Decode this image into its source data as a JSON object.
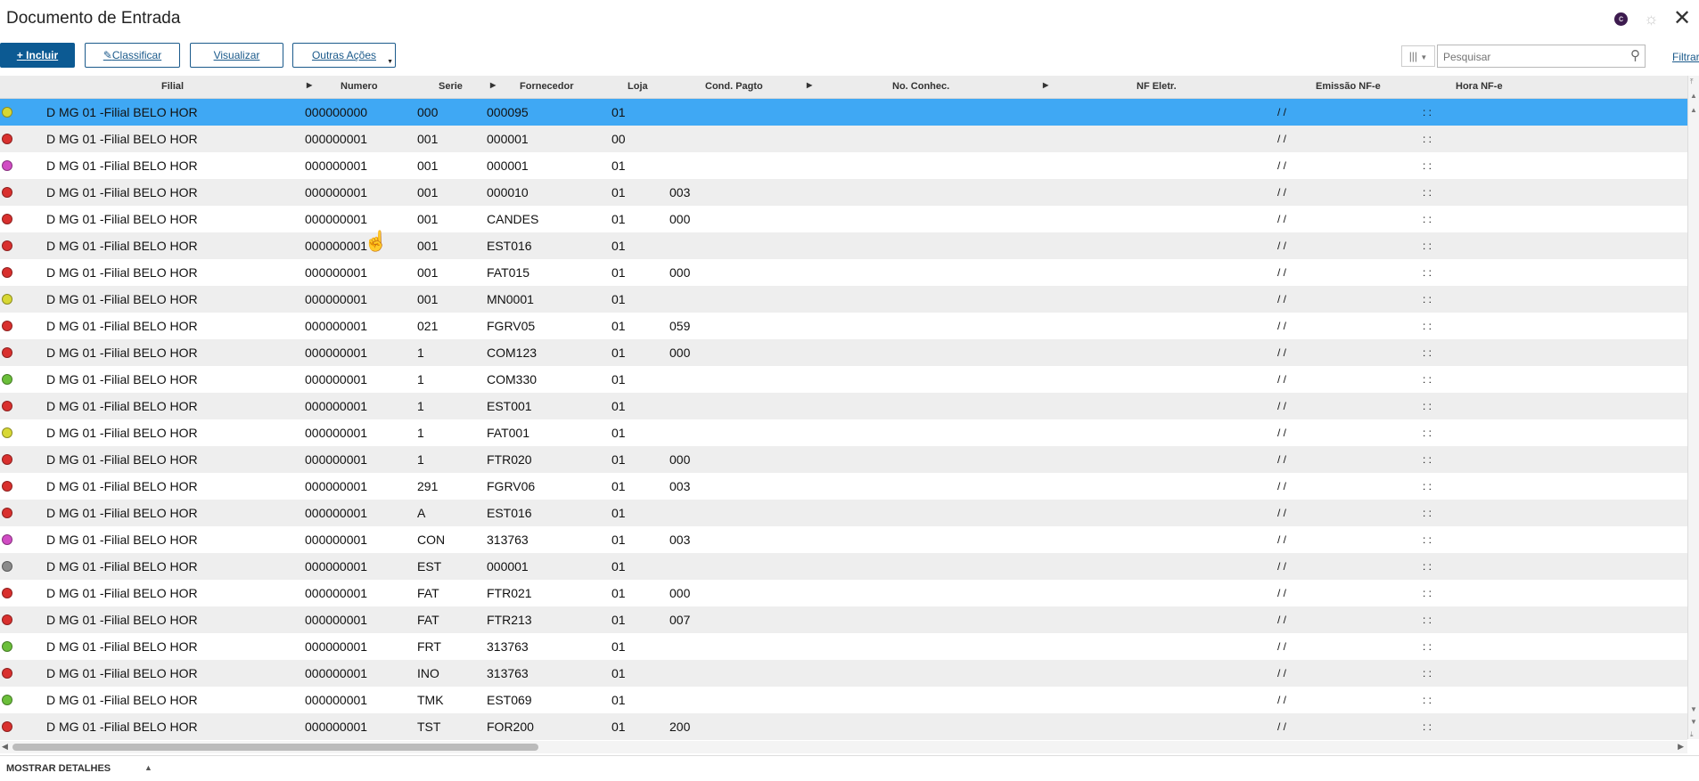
{
  "window": {
    "title": "Documento de Entrada",
    "app_badge": "c",
    "settings_icon": "gear-icon",
    "close_glyph": "✕"
  },
  "toolbar": {
    "include_label": "Incluir",
    "classify_label": "Classificar",
    "view_label": "Visualizar",
    "more_actions_label": "Outras Ações",
    "search_placeholder": "Pesquisar",
    "filter_label": "Filtrar"
  },
  "status_colors": {
    "yellow": "#d8d834",
    "red": "#d9302e",
    "pink": "#d14cc4",
    "green": "#6bbf3a",
    "gray": "#8a8a8a"
  },
  "selected_row_color": "#3fa8f4",
  "grid": {
    "headers": {
      "filial": "Filial",
      "numero": "Numero",
      "serie": "Serie",
      "fornecedor": "Fornecedor",
      "loja": "Loja",
      "cond_pagto": "Cond. Pagto",
      "no_conhec": "No. Conhec.",
      "nf_eletr": "NF Eletr.",
      "emissao": "Emissão NF-e",
      "hora": "Hora NF-e"
    },
    "rows": [
      {
        "status": "yellow",
        "filial": "D MG 01 -Filial BELO HOR",
        "numero": "000000000",
        "serie": "000",
        "fornecedor": "000095",
        "loja": "01",
        "cond": "",
        "emissao": "/ /",
        "hora": ": :"
      },
      {
        "status": "red",
        "filial": "D MG 01 -Filial BELO HOR",
        "numero": "000000001",
        "serie": "001",
        "fornecedor": "000001",
        "loja": "00",
        "cond": "",
        "emissao": "/ /",
        "hora": ": :"
      },
      {
        "status": "pink",
        "filial": "D MG 01 -Filial BELO HOR",
        "numero": "000000001",
        "serie": "001",
        "fornecedor": "000001",
        "loja": "01",
        "cond": "",
        "emissao": "/ /",
        "hora": ": :"
      },
      {
        "status": "red",
        "filial": "D MG 01 -Filial BELO HOR",
        "numero": "000000001",
        "serie": "001",
        "fornecedor": "000010",
        "loja": "01",
        "cond": "003",
        "emissao": "/ /",
        "hora": ": :"
      },
      {
        "status": "red",
        "filial": "D MG 01 -Filial BELO HOR",
        "numero": "000000001",
        "serie": "001",
        "fornecedor": "CANDES",
        "loja": "01",
        "cond": "000",
        "emissao": "/ /",
        "hora": ": :"
      },
      {
        "status": "red",
        "filial": "D MG 01 -Filial BELO HOR",
        "numero": "000000001",
        "serie": "001",
        "fornecedor": "EST016",
        "loja": "01",
        "cond": "",
        "emissao": "/ /",
        "hora": ": :"
      },
      {
        "status": "red",
        "filial": "D MG 01 -Filial BELO HOR",
        "numero": "000000001",
        "serie": "001",
        "fornecedor": "FAT015",
        "loja": "01",
        "cond": "000",
        "emissao": "/ /",
        "hora": ": :"
      },
      {
        "status": "yellow",
        "filial": "D MG 01 -Filial BELO HOR",
        "numero": "000000001",
        "serie": "001",
        "fornecedor": "MN0001",
        "loja": "01",
        "cond": "",
        "emissao": "/ /",
        "hora": ": :"
      },
      {
        "status": "red",
        "filial": "D MG 01 -Filial BELO HOR",
        "numero": "000000001",
        "serie": "021",
        "fornecedor": "FGRV05",
        "loja": "01",
        "cond": "059",
        "emissao": "/ /",
        "hora": ": :"
      },
      {
        "status": "red",
        "filial": "D MG 01 -Filial BELO HOR",
        "numero": "000000001",
        "serie": "1",
        "fornecedor": "COM123",
        "loja": "01",
        "cond": "000",
        "emissao": "/ /",
        "hora": ": :"
      },
      {
        "status": "green",
        "filial": "D MG 01 -Filial BELO HOR",
        "numero": "000000001",
        "serie": "1",
        "fornecedor": "COM330",
        "loja": "01",
        "cond": "",
        "emissao": "/ /",
        "hora": ": :"
      },
      {
        "status": "red",
        "filial": "D MG 01 -Filial BELO HOR",
        "numero": "000000001",
        "serie": "1",
        "fornecedor": "EST001",
        "loja": "01",
        "cond": "",
        "emissao": "/ /",
        "hora": ": :"
      },
      {
        "status": "yellow",
        "filial": "D MG 01 -Filial BELO HOR",
        "numero": "000000001",
        "serie": "1",
        "fornecedor": "FAT001",
        "loja": "01",
        "cond": "",
        "emissao": "/ /",
        "hora": ": :"
      },
      {
        "status": "red",
        "filial": "D MG 01 -Filial BELO HOR",
        "numero": "000000001",
        "serie": "1",
        "fornecedor": "FTR020",
        "loja": "01",
        "cond": "000",
        "emissao": "/ /",
        "hora": ": :"
      },
      {
        "status": "red",
        "filial": "D MG 01 -Filial BELO HOR",
        "numero": "000000001",
        "serie": "291",
        "fornecedor": "FGRV06",
        "loja": "01",
        "cond": "003",
        "emissao": "/ /",
        "hora": ": :"
      },
      {
        "status": "red",
        "filial": "D MG 01 -Filial BELO HOR",
        "numero": "000000001",
        "serie": "A",
        "fornecedor": "EST016",
        "loja": "01",
        "cond": "",
        "emissao": "/ /",
        "hora": ": :"
      },
      {
        "status": "pink",
        "filial": "D MG 01 -Filial BELO HOR",
        "numero": "000000001",
        "serie": "CON",
        "fornecedor": "313763",
        "loja": "01",
        "cond": "003",
        "emissao": "/ /",
        "hora": ": :"
      },
      {
        "status": "gray",
        "filial": "D MG 01 -Filial BELO HOR",
        "numero": "000000001",
        "serie": "EST",
        "fornecedor": "000001",
        "loja": "01",
        "cond": "",
        "emissao": "/ /",
        "hora": ": :"
      },
      {
        "status": "red",
        "filial": "D MG 01 -Filial BELO HOR",
        "numero": "000000001",
        "serie": "FAT",
        "fornecedor": "FTR021",
        "loja": "01",
        "cond": "000",
        "emissao": "/ /",
        "hora": ": :"
      },
      {
        "status": "red",
        "filial": "D MG 01 -Filial BELO HOR",
        "numero": "000000001",
        "serie": "FAT",
        "fornecedor": "FTR213",
        "loja": "01",
        "cond": "007",
        "emissao": "/ /",
        "hora": ": :"
      },
      {
        "status": "green",
        "filial": "D MG 01 -Filial BELO HOR",
        "numero": "000000001",
        "serie": "FRT",
        "fornecedor": "313763",
        "loja": "01",
        "cond": "",
        "emissao": "/ /",
        "hora": ": :"
      },
      {
        "status": "red",
        "filial": "D MG 01 -Filial BELO HOR",
        "numero": "000000001",
        "serie": "INO",
        "fornecedor": "313763",
        "loja": "01",
        "cond": "",
        "emissao": "/ /",
        "hora": ": :"
      },
      {
        "status": "green",
        "filial": "D MG 01 -Filial BELO HOR",
        "numero": "000000001",
        "serie": "TMK",
        "fornecedor": "EST069",
        "loja": "01",
        "cond": "",
        "emissao": "/ /",
        "hora": ": :"
      },
      {
        "status": "red",
        "filial": "D MG 01 -Filial BELO HOR",
        "numero": "000000001",
        "serie": "TST",
        "fornecedor": "FOR200",
        "loja": "01",
        "cond": "200",
        "emissao": "/ /",
        "hora": ": :"
      }
    ]
  },
  "footer": {
    "details_label": "MOSTRAR DETALHES"
  }
}
